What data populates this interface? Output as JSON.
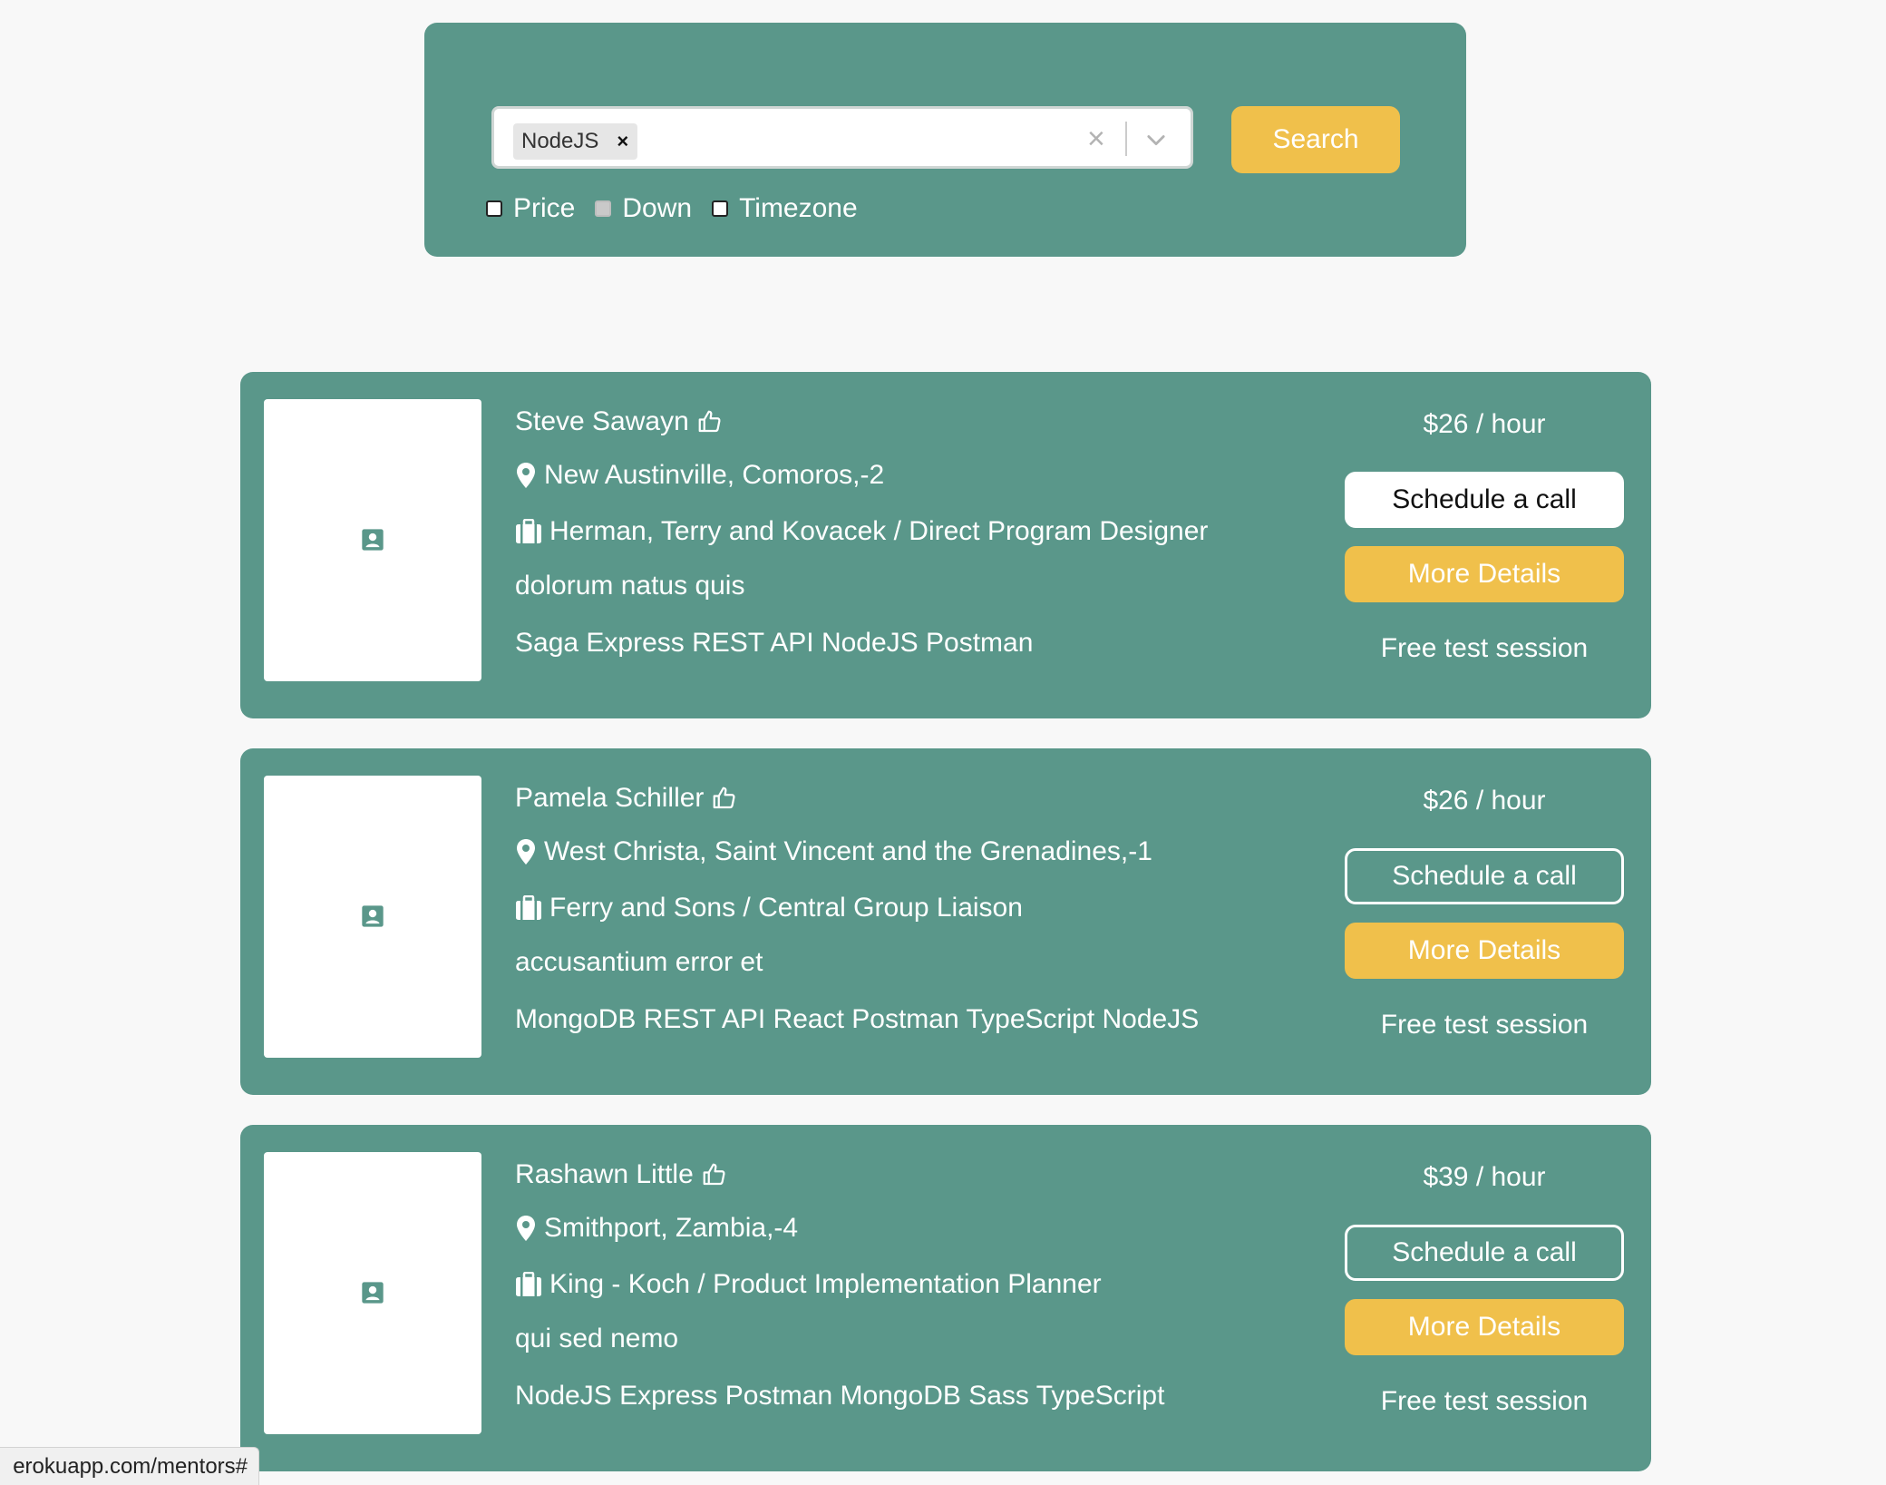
{
  "search": {
    "selected_tag": "NodeJS",
    "button_label": "Search",
    "filters": [
      {
        "label": "Price",
        "checked": false
      },
      {
        "label": "Down",
        "checked": false,
        "disabled": true
      },
      {
        "label": "Timezone",
        "checked": false
      }
    ]
  },
  "mentors": [
    {
      "name": "Steve Sawayn",
      "location": "New Austinville, Comoros,-2",
      "job": "Herman, Terry and Kovacek / Direct Program Designer",
      "bio": "dolorum natus quis",
      "skills": "Saga Express REST API NodeJS Postman",
      "price": "$26 / hour",
      "schedule_label": "Schedule a call",
      "details_label": "More Details",
      "free_label": "Free test session"
    },
    {
      "name": "Pamela Schiller",
      "location": "West Christa, Saint Vincent and the Grenadines,-1",
      "job": "Ferry and Sons / Central Group Liaison",
      "bio": "accusantium error et",
      "skills": "MongoDB REST API React Postman TypeScript NodeJS",
      "price": "$26 / hour",
      "schedule_label": "Schedule a call",
      "details_label": "More Details",
      "free_label": "Free test session"
    },
    {
      "name": "Rashawn Little",
      "location": "Smithport, Zambia,-4",
      "job": "King - Koch / Product Implementation Planner",
      "bio": "qui sed nemo",
      "skills": "NodeJS Express Postman MongoDB Sass TypeScript",
      "price": "$39 / hour",
      "schedule_label": "Schedule a call",
      "details_label": "More Details",
      "free_label": "Free test session"
    }
  ],
  "status_bar": {
    "url": "erokuapp.com/mentors#"
  },
  "colors": {
    "card_bg": "#5a978a",
    "accent": "#f0c04b",
    "page_bg": "#f8f8f8"
  },
  "icons": [
    "thumbs-up-icon",
    "map-pin-icon",
    "briefcase-icon",
    "contact-placeholder-icon",
    "close-icon",
    "chevron-down-icon"
  ]
}
